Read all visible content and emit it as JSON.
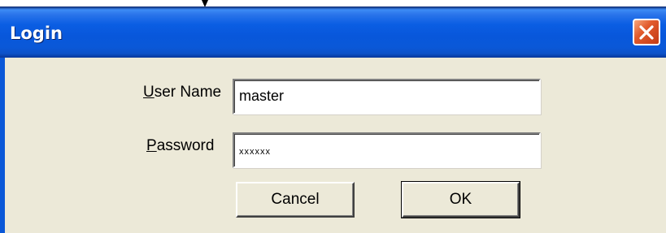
{
  "window": {
    "title": "Login",
    "title_color": "#ffffff",
    "titlebar_color": "#0a58d8",
    "client_color": "#ece9d8"
  },
  "title_buttons": {
    "close_icon": "close-icon",
    "close_color": "#e15a2c"
  },
  "form": {
    "username_label_accel": "U",
    "username_label_rest": "ser Name",
    "username_value": "master",
    "password_label_accel": "P",
    "password_label_rest": "assword",
    "password_value": "xxxxxx"
  },
  "buttons": {
    "cancel_label": "Cancel",
    "ok_label": "OK"
  }
}
